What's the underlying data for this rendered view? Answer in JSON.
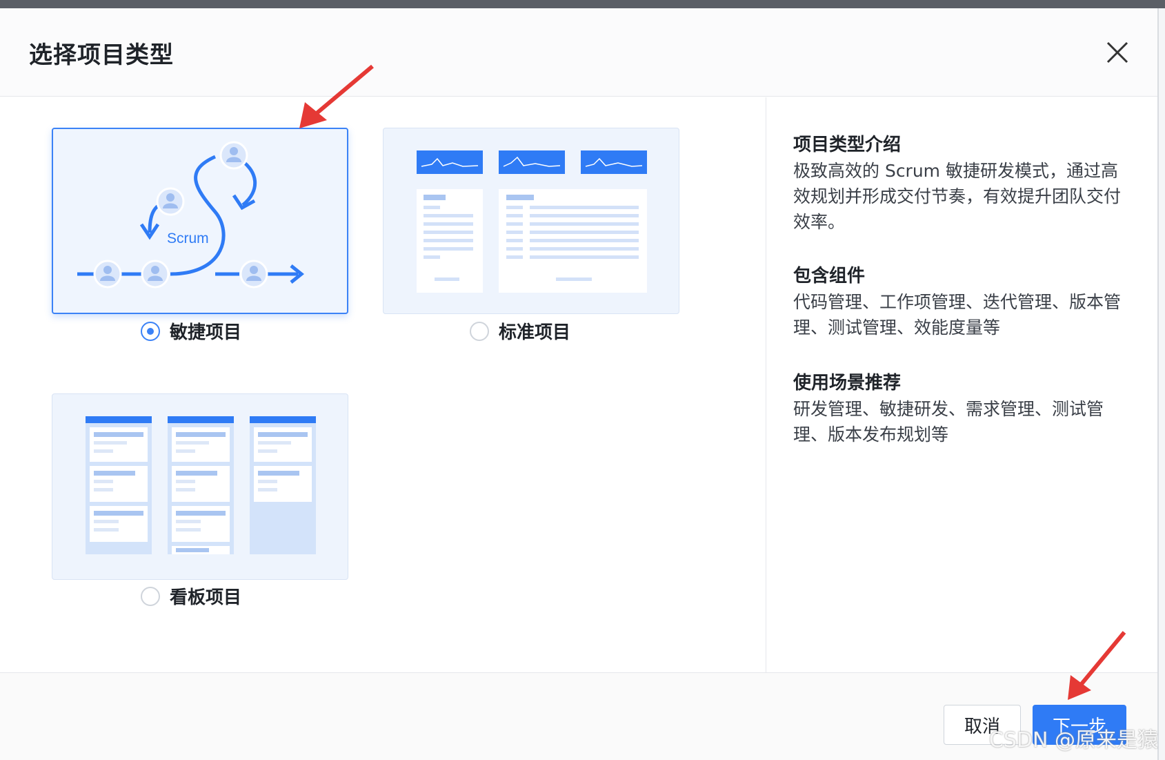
{
  "dialog": {
    "title": "选择项目类型",
    "close_icon": "close-icon"
  },
  "options": [
    {
      "label": "敏捷项目",
      "selected": true,
      "illustration": "scrum-cycle",
      "badge": "Scrum"
    },
    {
      "label": "标准项目",
      "selected": false,
      "illustration": "standard-layout"
    },
    {
      "label": "看板项目",
      "selected": false,
      "illustration": "kanban-board"
    }
  ],
  "info": {
    "intro_title": "项目类型介绍",
    "intro_text": "极致高效的 Scrum 敏捷研发模式，通过高效规划并形成交付节奏，有效提升团队交付效率。",
    "components_title": "包含组件",
    "components_text": "代码管理、工作项管理、迭代管理、版本管理、测试管理、效能度量等",
    "scenarios_title": "使用场景推荐",
    "scenarios_text": "研发管理、敏捷研发、需求管理、测试管理、版本发布规划等"
  },
  "footer": {
    "cancel_label": "取消",
    "next_label": "下一步"
  },
  "watermark": "CSDN @原来是猿",
  "colors": {
    "accent": "#2f7bf5",
    "annotation_arrow": "#e53935"
  }
}
